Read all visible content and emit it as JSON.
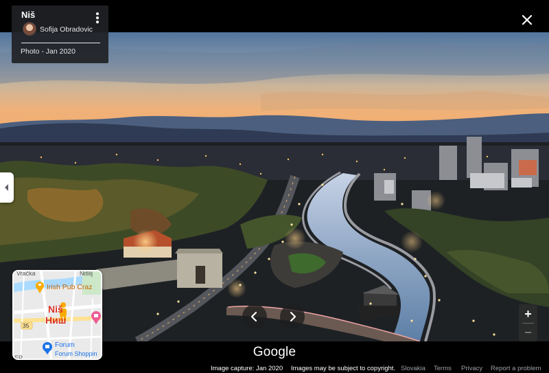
{
  "info_card": {
    "title": "Niš",
    "author": "Sofija Obradovic",
    "photo_date": "Photo - Jan 2020"
  },
  "minimap": {
    "labels": {
      "top_left": "Vračka",
      "top_right": "Nišlij",
      "poi_pub": "Irish Pub Craz",
      "city_latin": "Niš",
      "city_cyrillic": "Ниш",
      "road_number": "35",
      "poi_forum": "Forum",
      "poi_forum_sub": "Forum Shoppin",
      "bottom_left": "EP"
    },
    "colors": {
      "pin": "#ea4335",
      "pub": "#f9ab00",
      "forum": "#1a73e8",
      "pegman": "#f9ab00"
    }
  },
  "bottom": {
    "logo": "Google",
    "image_capture": "Image capture: Jan 2020",
    "copyright": "Images may be subject to copyright.",
    "country": "Slovakia",
    "terms": "Terms",
    "privacy": "Privacy",
    "report": "Report a problem"
  },
  "controls": {
    "zoom_in": "+",
    "zoom_out": "−"
  }
}
